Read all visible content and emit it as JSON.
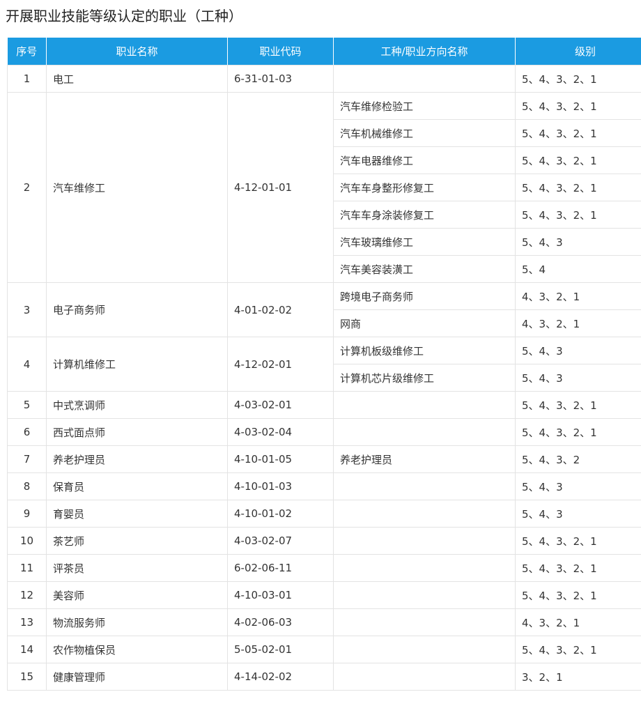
{
  "title": "开展职业技能等级认定的职业（工种）",
  "colors": {
    "header_bg": "#1b9be1",
    "header_text": "#ffffff",
    "border": "#e3e3e3",
    "text": "#333333"
  },
  "table": {
    "headers": [
      "序号",
      "职业名称",
      "职业代码",
      "工种/职业方向名称",
      "级别"
    ],
    "rows": [
      {
        "no": "1",
        "name": "电工",
        "code": "6-31-01-03",
        "subs": [
          {
            "type": "",
            "level": "5、4、3、2、1"
          }
        ]
      },
      {
        "no": "2",
        "name": "汽车维修工",
        "code": "4-12-01-01",
        "subs": [
          {
            "type": "汽车维修检验工",
            "level": "5、4、3、2、1"
          },
          {
            "type": "汽车机械维修工",
            "level": "5、4、3、2、1"
          },
          {
            "type": "汽车电器维修工",
            "level": "5、4、3、2、1"
          },
          {
            "type": "汽车车身整形修复工",
            "level": "5、4、3、2、1"
          },
          {
            "type": "汽车车身涂装修复工",
            "level": "5、4、3、2、1"
          },
          {
            "type": "汽车玻璃维修工",
            "level": "5、4、3"
          },
          {
            "type": "汽车美容装潢工",
            "level": "5、4"
          }
        ]
      },
      {
        "no": "3",
        "name": "电子商务师",
        "code": "4-01-02-02",
        "subs": [
          {
            "type": "跨境电子商务师",
            "level": "4、3、2、1"
          },
          {
            "type": "网商",
            "level": "4、3、2、1"
          }
        ]
      },
      {
        "no": "4",
        "name": "计算机维修工",
        "code": "4-12-02-01",
        "subs": [
          {
            "type": "计算机板级维修工",
            "level": "5、4、3"
          },
          {
            "type": "计算机芯片级维修工",
            "level": "5、4、3"
          }
        ]
      },
      {
        "no": "5",
        "name": "中式烹调师",
        "code": "4-03-02-01",
        "subs": [
          {
            "type": "",
            "level": "5、4、3、2、1"
          }
        ]
      },
      {
        "no": "6",
        "name": "西式面点师",
        "code": "4-03-02-04",
        "subs": [
          {
            "type": "",
            "level": "5、4、3、2、1"
          }
        ]
      },
      {
        "no": "7",
        "name": "养老护理员",
        "code": "4-10-01-05",
        "subs": [
          {
            "type": "养老护理员",
            "level": "5、4、3、2"
          }
        ]
      },
      {
        "no": "8",
        "name": "保育员",
        "code": "4-10-01-03",
        "subs": [
          {
            "type": "",
            "level": "5、4、3"
          }
        ]
      },
      {
        "no": "9",
        "name": "育婴员",
        "code": "4-10-01-02",
        "subs": [
          {
            "type": "",
            "level": "5、4、3"
          }
        ]
      },
      {
        "no": "10",
        "name": "茶艺师",
        "code": "4-03-02-07",
        "subs": [
          {
            "type": "",
            "level": "5、4、3、2、1"
          }
        ]
      },
      {
        "no": "11",
        "name": "评茶员",
        "code": "6-02-06-11",
        "subs": [
          {
            "type": "",
            "level": "5、4、3、2、1"
          }
        ]
      },
      {
        "no": "12",
        "name": "美容师",
        "code": "4-10-03-01",
        "subs": [
          {
            "type": "",
            "level": "5、4、3、2、1"
          }
        ]
      },
      {
        "no": "13",
        "name": "物流服务师",
        "code": "4-02-06-03",
        "subs": [
          {
            "type": "",
            "level": "4、3、2、1"
          }
        ]
      },
      {
        "no": "14",
        "name": "农作物植保员",
        "code": "5-05-02-01",
        "subs": [
          {
            "type": "",
            "level": "5、4、3、2、1"
          }
        ]
      },
      {
        "no": "15",
        "name": "健康管理师",
        "code": "4-14-02-02",
        "subs": [
          {
            "type": "",
            "level": "3、2、1"
          }
        ]
      }
    ]
  }
}
